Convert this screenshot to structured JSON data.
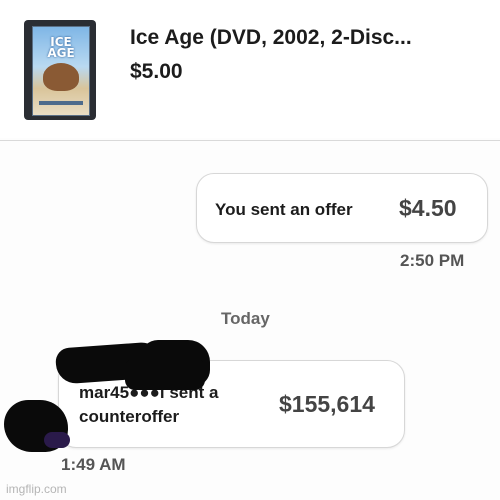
{
  "listing": {
    "thumbnail_title": "ICE AGE",
    "title": "Ice Age (DVD, 2002, 2-Disc...",
    "price": "$5.00"
  },
  "messages": {
    "sent_offer": {
      "label": "You sent an offer",
      "amount": "$4.50",
      "time": "2:50 PM"
    },
    "date_separator": "Today",
    "counteroffer": {
      "label": "mar45●●●l sent a counteroffer",
      "amount": "$155,614",
      "time": "1:49 AM"
    }
  },
  "watermark": "imgflip.com"
}
